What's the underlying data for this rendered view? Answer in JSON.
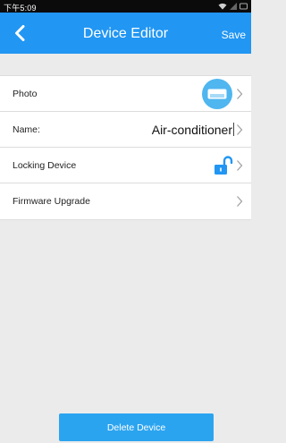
{
  "status_bar": {
    "time": "下午5:09"
  },
  "header": {
    "title": "Device Editor",
    "save_label": "Save"
  },
  "rows": [
    {
      "label": "Photo"
    },
    {
      "label": "Name:",
      "value": "Air-conditioner"
    },
    {
      "label": "Locking Device"
    },
    {
      "label": "Firmware Upgrade"
    }
  ],
  "icons": {
    "back": "chevron-left-icon",
    "row_arrow": "chevron-right-icon",
    "photo": "air-conditioner-icon",
    "lock": "unlocked-padlock-icon"
  },
  "footer": {
    "delete_label": "Delete Device"
  },
  "colors": {
    "header": "#2196f3",
    "accent": "#4fb6ef",
    "button": "#2ba4f0",
    "background": "#ebebeb"
  }
}
